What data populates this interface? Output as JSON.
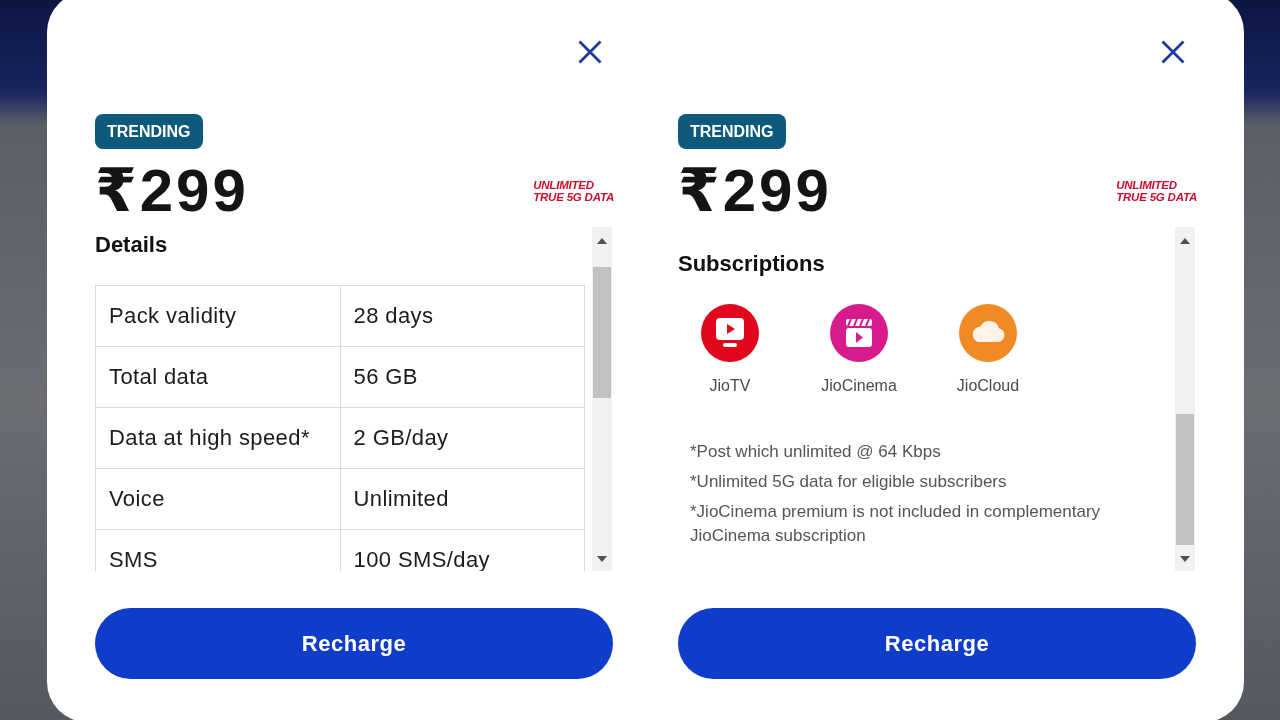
{
  "panels": [
    {
      "badge": "TRENDING",
      "price": "₹299",
      "promo": [
        "UNLIMITED",
        "TRUE 5G DATA"
      ],
      "section": {
        "kind": "details",
        "title": "Details",
        "rows": [
          {
            "label": "Pack validity",
            "value": "28 days"
          },
          {
            "label": "Total data",
            "value": "56 GB"
          },
          {
            "label": "Data at high speed*",
            "value": "2 GB/day"
          },
          {
            "label": "Voice",
            "value": "Unlimited"
          },
          {
            "label": "SMS",
            "value": "100 SMS/day"
          }
        ]
      },
      "button": "Recharge"
    },
    {
      "badge": "TRENDING",
      "price": "₹299",
      "promo": [
        "UNLIMITED",
        "TRUE 5G DATA"
      ],
      "section": {
        "kind": "subscriptions",
        "title": "Subscriptions",
        "items": [
          {
            "name": "JioTV",
            "kind": "tv",
            "color": "#e1061b"
          },
          {
            "name": "JioCinema",
            "kind": "clapper",
            "color": "#d81b8c"
          },
          {
            "name": "JioCloud",
            "kind": "cloud",
            "color": "#f08a24"
          }
        ],
        "notes": [
          "*Post which unlimited @ 64 Kbps",
          "*Unlimited 5G data for eligible subscribers",
          "*JioCinema premium is not included in complementary JioCinema subscription"
        ]
      },
      "button": "Recharge"
    }
  ]
}
